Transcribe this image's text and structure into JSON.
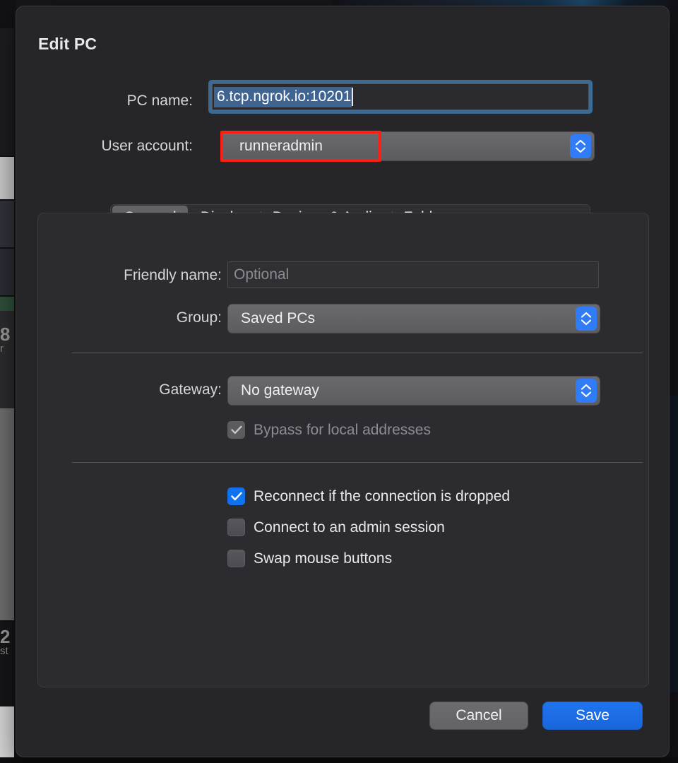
{
  "dialog": {
    "title": "Edit PC",
    "fields": {
      "pc_name_label": "PC name:",
      "pc_name_value": "6.tcp.ngrok.io:10201",
      "user_account_label": "User account:",
      "user_account_value": "runneradmin"
    },
    "tabs": [
      {
        "label": "General",
        "selected": true
      },
      {
        "label": "Display",
        "selected": false
      },
      {
        "label": "Devices & Audio",
        "selected": false
      },
      {
        "label": "Folders",
        "selected": false
      }
    ],
    "general": {
      "friendly_name_label": "Friendly name:",
      "friendly_name_value": "",
      "friendly_name_placeholder": "Optional",
      "group_label": "Group:",
      "group_value": "Saved PCs",
      "gateway_label": "Gateway:",
      "gateway_value": "No gateway",
      "bypass_label": "Bypass for local addresses",
      "bypass_checked": "checked",
      "reconnect_label": "Reconnect if the connection is dropped",
      "reconnect_checked": "checked",
      "admin_session_label": "Connect to an admin session",
      "admin_session_checked": "unchecked",
      "swap_mouse_label": "Swap mouse buttons",
      "swap_mouse_checked": "unchecked"
    },
    "footer": {
      "cancel_label": "Cancel",
      "save_label": "Save"
    }
  },
  "annotation": {
    "type": "highlight-rectangle",
    "color": "#ff1f13",
    "target": "user-account-popup"
  },
  "icons": {
    "stepper": "up-down-chevron-icon",
    "checkmark": "check-icon"
  },
  "colors": {
    "accent_blue": "#1072ef",
    "dialog_bg": "#262629",
    "panel_bg": "#2b2b30",
    "focus_ring": "#3b6a95",
    "selection": "#3f6491",
    "annotation_red": "#ff1f13"
  },
  "background": {
    "fragments": [
      "8",
      "r",
      "2",
      "st"
    ]
  }
}
